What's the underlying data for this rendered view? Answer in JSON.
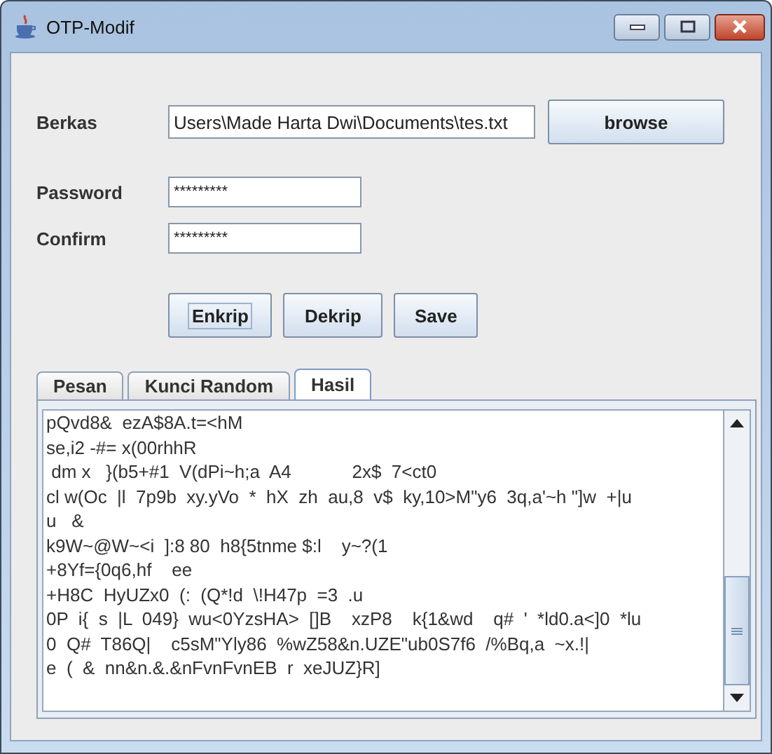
{
  "window": {
    "title": "OTP-Modif"
  },
  "file": {
    "label": "Berkas",
    "value": "Users\\Made Harta Dwi\\Documents\\tes.txt",
    "button": "browse"
  },
  "password": {
    "label": "Password",
    "value": "*********"
  },
  "confirm": {
    "label": "Confirm",
    "value": "*********"
  },
  "buttons": [
    {
      "label": "Enkrip",
      "focused": true
    },
    {
      "label": "Dekrip",
      "focused": false
    },
    {
      "label": "Save",
      "focused": false
    }
  ],
  "tabs": [
    {
      "label": "Pesan",
      "selected": false
    },
    {
      "label": "Kunci Random",
      "selected": false
    },
    {
      "label": "Hasil",
      "selected": true
    }
  ],
  "output_lines": [
    "pQvd8&  ezA$8A.t=<hM",
    "se,i2 -#= x(00rhhR",
    " dm x   }(b5+#1  V(dPi~h;a  A4            2x$  7<ct0",
    "cl w(Oc  |l  7p9b  xy.yVo  *  hX  zh  au,8  v$  ky,10>M\"y6  3q,a'~h \"]w  +|u",
    "u   &",
    "k9W~@W~<i  ]:8 80  h8{5tnme $:l    y~?(1",
    "+8Yf={0q6,hf    ee",
    "+H8C  HyUZx0  (:  (Q*!d  \\!H47p  =3  .u",
    "0P  i{  s  |L  049}  wu<0YzsHA>  []B    xzP8    k{1&wd    q#  '  *ld0.a<]0  *lu",
    "0  Q#  T86Q|    c5sM\"Yly86  %wZ58&n.UZE\"ub0S7f6  /%Bq,a  ~x.!|",
    "e  (  &  nn&n.&.&nFvnFvnEB  r  xeJUZ}R]"
  ]
}
